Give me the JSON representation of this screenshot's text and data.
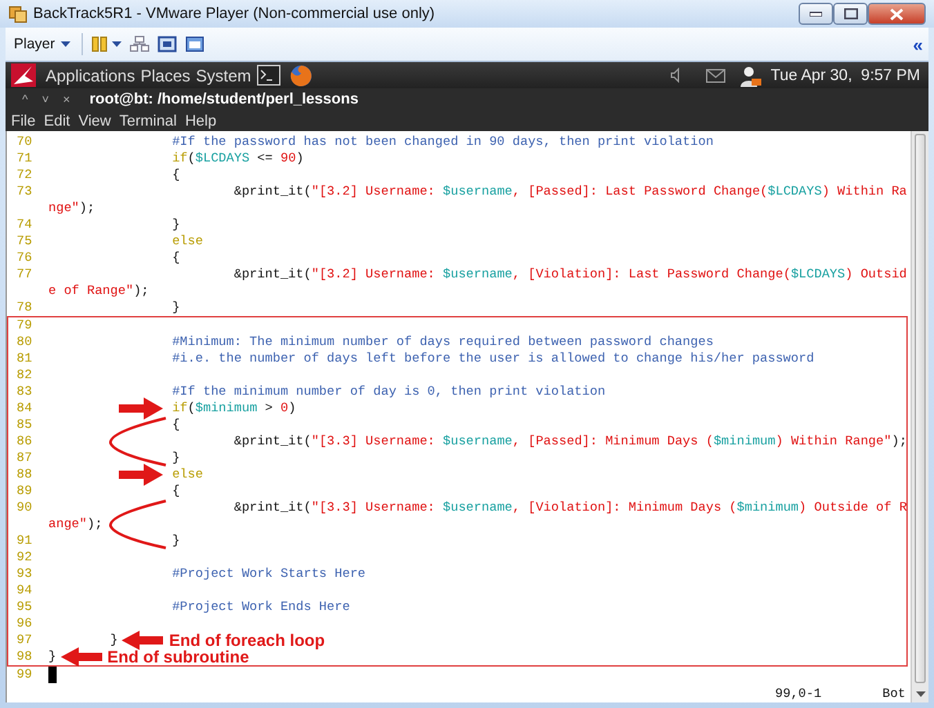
{
  "window": {
    "title": "BackTrack5R1 - VMware Player (Non-commercial use only)"
  },
  "toolbar": {
    "player_menu": "Player",
    "collapse": "«"
  },
  "panel": {
    "menus": [
      "Applications",
      "Places",
      "System"
    ],
    "clock": "Tue Apr 30,  9:57 PM"
  },
  "terminal": {
    "title": "root@bt: /home/student/perl_lessons",
    "title_buttons": [
      "^",
      "˅",
      "×"
    ],
    "menu": [
      "File",
      "Edit",
      "View",
      "Terminal",
      "Help"
    ]
  },
  "editor": {
    "sections": [
      {
        "boxed": false,
        "rows": [
          {
            "number": "70",
            "segments": [
              {
                "text": "\t\t#If the password has not been changed in 90 days, then print violation",
                "kind": "comment"
              }
            ]
          },
          {
            "number": "71",
            "segments": [
              {
                "text": "\t\tif",
                "kind": "keyword"
              },
              {
                "text": "(",
                "kind": "plain"
              },
              {
                "text": "$LCDAYS",
                "kind": "var"
              },
              {
                "text": " <= ",
                "kind": "plain"
              },
              {
                "text": "90",
                "kind": "number"
              },
              {
                "text": ")",
                "kind": "plain"
              }
            ]
          },
          {
            "number": "72",
            "segments": [
              {
                "text": "\t\t{",
                "kind": "plain"
              }
            ]
          },
          {
            "number": "73",
            "segments": [
              {
                "text": "\t\t\t&print_it(",
                "kind": "plain"
              },
              {
                "text": "\"[3.2] Username: ",
                "kind": "string"
              },
              {
                "text": "$username",
                "kind": "var"
              },
              {
                "text": ", [Passed]: Last Password Change(",
                "kind": "string"
              },
              {
                "text": "$LCDAYS",
                "kind": "var"
              },
              {
                "text": ") Within Ra",
                "kind": "string"
              }
            ]
          },
          {
            "segments": [
              {
                "text": "nge\"",
                "kind": "string"
              },
              {
                "text": ");",
                "kind": "plain"
              }
            ]
          },
          {
            "number": "74",
            "segments": [
              {
                "text": "\t\t}",
                "kind": "plain"
              }
            ]
          },
          {
            "number": "75",
            "segments": [
              {
                "text": "\t\telse",
                "kind": "keyword"
              }
            ]
          },
          {
            "number": "76",
            "segments": [
              {
                "text": "\t\t{",
                "kind": "plain"
              }
            ]
          },
          {
            "number": "77",
            "segments": [
              {
                "text": "\t\t\t&print_it(",
                "kind": "plain"
              },
              {
                "text": "\"[3.2] Username: ",
                "kind": "string"
              },
              {
                "text": "$username",
                "kind": "var"
              },
              {
                "text": ", [Violation]: Last Password Change(",
                "kind": "string"
              },
              {
                "text": "$LCDAYS",
                "kind": "var"
              },
              {
                "text": ") Outsid",
                "kind": "string"
              }
            ]
          },
          {
            "segments": [
              {
                "text": "e of Range\"",
                "kind": "string"
              },
              {
                "text": ");",
                "kind": "plain"
              }
            ]
          },
          {
            "number": "78",
            "segments": [
              {
                "text": "\t\t}",
                "kind": "plain"
              }
            ]
          }
        ]
      },
      {
        "boxed": true,
        "rows": [
          {
            "number": "79",
            "segments": []
          },
          {
            "number": "80",
            "segments": [
              {
                "text": "\t\t#Minimum: The minimum number of days required between password changes",
                "kind": "comment"
              }
            ]
          },
          {
            "number": "81",
            "segments": [
              {
                "text": "\t\t#i.e. the number of days left before the user is allowed to change his/her password",
                "kind": "comment"
              }
            ]
          },
          {
            "number": "82",
            "segments": []
          },
          {
            "number": "83",
            "segments": [
              {
                "text": "\t\t#If the minimum number of day is 0, then print violation",
                "kind": "comment"
              }
            ]
          },
          {
            "number": "84",
            "annotation": {
              "kind": "arrow"
            },
            "segments": [
              {
                "text": "\t\tif",
                "kind": "keyword"
              },
              {
                "text": "(",
                "kind": "plain"
              },
              {
                "text": "$minimum",
                "kind": "var"
              },
              {
                "text": " > ",
                "kind": "plain"
              },
              {
                "text": "0",
                "kind": "number"
              },
              {
                "text": ")",
                "kind": "plain"
              }
            ]
          },
          {
            "number": "85",
            "segments": [
              {
                "text": "\t\t{",
                "kind": "plain"
              }
            ]
          },
          {
            "number": "86",
            "annotation": {
              "kind": "curve"
            },
            "segments": [
              {
                "text": "\t\t\t&print_it(",
                "kind": "plain"
              },
              {
                "text": "\"[3.3] Username: ",
                "kind": "string"
              },
              {
                "text": "$username",
                "kind": "var"
              },
              {
                "text": ", [Passed]: Minimum Days (",
                "kind": "string"
              },
              {
                "text": "$minimum",
                "kind": "var"
              },
              {
                "text": ") Within Range\"",
                "kind": "string"
              },
              {
                "text": ");",
                "kind": "plain"
              }
            ]
          },
          {
            "number": "87",
            "segments": [
              {
                "text": "\t\t}",
                "kind": "plain"
              }
            ]
          },
          {
            "number": "88",
            "annotation": {
              "kind": "arrow"
            },
            "segments": [
              {
                "text": "\t\telse",
                "kind": "keyword"
              }
            ]
          },
          {
            "number": "89",
            "segments": [
              {
                "text": "\t\t{",
                "kind": "plain"
              }
            ]
          },
          {
            "number": "90",
            "segments": [
              {
                "text": "\t\t\t&print_it(",
                "kind": "plain"
              },
              {
                "text": "\"[3.3] Username: ",
                "kind": "string"
              },
              {
                "text": "$username",
                "kind": "var"
              },
              {
                "text": ", [Violation]: Minimum Days (",
                "kind": "string"
              },
              {
                "text": "$minimum",
                "kind": "var"
              },
              {
                "text": ") Outside of R",
                "kind": "string"
              }
            ]
          },
          {
            "annotation": {
              "kind": "curve"
            },
            "segments": [
              {
                "text": "ange\"",
                "kind": "string"
              },
              {
                "text": ");",
                "kind": "plain"
              }
            ]
          },
          {
            "number": "91",
            "segments": [
              {
                "text": "\t\t}",
                "kind": "plain"
              }
            ]
          },
          {
            "number": "92",
            "segments": []
          },
          {
            "number": "93",
            "segments": [
              {
                "text": "\t\t#Project Work Starts Here",
                "kind": "comment"
              }
            ]
          },
          {
            "number": "94",
            "segments": []
          },
          {
            "number": "95",
            "segments": [
              {
                "text": "\t\t#Project Work Ends Here",
                "kind": "comment"
              }
            ]
          },
          {
            "number": "96",
            "segments": []
          },
          {
            "number": "97",
            "annotation": {
              "kind": "labeled-arrow",
              "label": "End of foreach loop"
            },
            "segments": [
              {
                "text": "\t}",
                "kind": "plain"
              }
            ]
          },
          {
            "number": "98",
            "annotation": {
              "kind": "labeled-arrow",
              "label": "End of subroutine"
            },
            "segments": [
              {
                "text": "}",
                "kind": "plain"
              }
            ]
          }
        ]
      },
      {
        "boxed": false,
        "rows": [
          {
            "number": "99",
            "cursor": true,
            "segments": []
          }
        ]
      }
    ],
    "status": {
      "position": "99,0-1",
      "scroll": "Bot"
    }
  }
}
